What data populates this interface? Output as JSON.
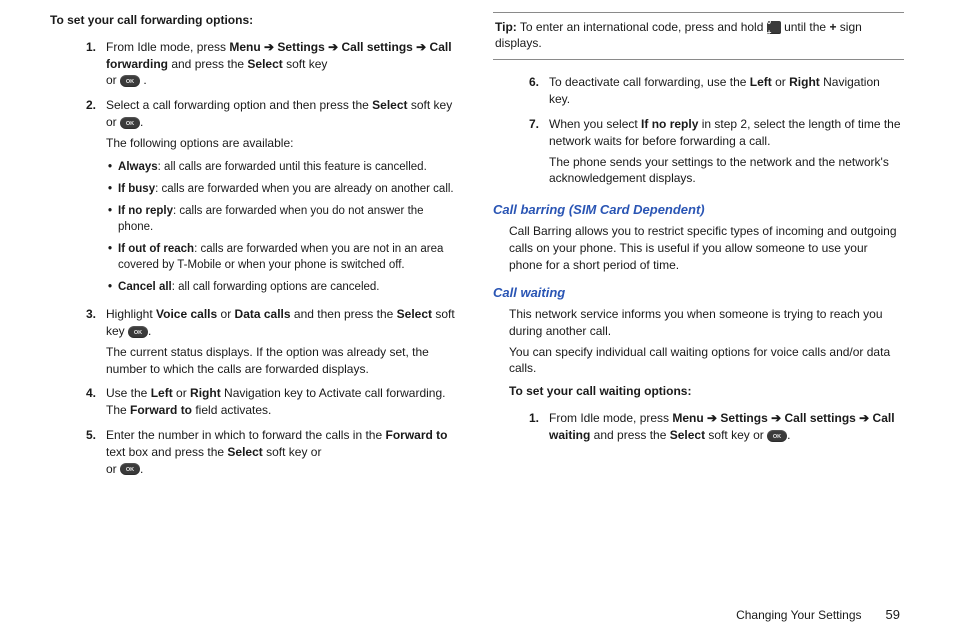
{
  "left": {
    "heading": "To set your call forwarding options:",
    "step1": {
      "prefix": "From Idle mode, press ",
      "nav": "Menu ➔ Settings ➔ Call settings ➔ Call forwarding",
      "mid": " and press the ",
      "select": "Select",
      "suffix1": " soft key",
      "or": "or ",
      "dot": "."
    },
    "step2": {
      "line1a": "Select a call forwarding option and then press the ",
      "select": "Select",
      "line1b": " soft key or ",
      "dot": ".",
      "line2": "The following options are available:",
      "bullets": {
        "b1_b": "Always",
        "b1_t": ": all calls are forwarded until this feature is cancelled.",
        "b2_b": "If busy",
        "b2_t": ": calls are forwarded when you are already on another call.",
        "b3_b": "If no reply",
        "b3_t": ": calls are forwarded when you do not answer the phone.",
        "b4_b": "If out of reach",
        "b4_t": ": calls are forwarded when you are not in an area covered by T-Mobile or when your phone is switched off.",
        "b5_b": "Cancel all",
        "b5_t": ": all call forwarding options are canceled."
      }
    },
    "step3": {
      "a": "Highlight ",
      "voice": "Voice calls",
      "or": " or ",
      "data": "Data calls",
      "b": " and then press the ",
      "select": "Select",
      "sk": " soft key ",
      "dot": ".",
      "line2": "The current status displays. If the option was already set, the number to which the calls are forwarded displays."
    },
    "step4": {
      "a": "Use the ",
      "left": "Left",
      "or": " or ",
      "right": "Right",
      "b": " Navigation key to Activate call forwarding. The ",
      "fwd": "Forward to",
      "c": " field activates."
    },
    "step5": {
      "a": "Enter the number in which to forward the calls in the ",
      "fwd": "Forward to",
      "b": " text box and press the ",
      "select": "Select",
      "c": " soft key or ",
      "dot": "."
    }
  },
  "right": {
    "tip": {
      "label": "Tip:",
      "a": " To enter an international code, press and hold ",
      "b": " until the ",
      "plus": "+",
      "c": " sign displays."
    },
    "step6": {
      "a": "To deactivate call forwarding, use the ",
      "left": "Left",
      "or": " or ",
      "right": "Right",
      "b": " Navigation key."
    },
    "step7": {
      "a": "When you select ",
      "ifno": "If no reply",
      "b": " in step 2, select the length of time the network waits for before forwarding a call.",
      "line2": "The phone sends your settings to the network and the network's acknowledgement displays."
    },
    "barring": {
      "title": "Call barring (SIM Card Dependent)",
      "body": "Call Barring allows you to restrict specific types of incoming and outgoing calls on your phone. This is useful if you allow someone to use your phone for a short period of time."
    },
    "waiting": {
      "title": "Call waiting",
      "p1": "This network service informs you when someone is trying to reach you during another call.",
      "p2": "You can specify individual call waiting options for voice calls and/or data calls.",
      "heading": "To set your call waiting options:",
      "step1": {
        "a": "From Idle mode, press ",
        "nav": "Menu ➔ Settings ➔ Call settings ➔ Call waiting",
        "b": " and press the ",
        "select": "Select",
        "c": " soft key or ",
        "dot": "."
      }
    }
  },
  "footer": {
    "section": "Changing Your Settings",
    "page": "59"
  },
  "icons": {
    "ok": "OK",
    "zero": "0 +"
  }
}
